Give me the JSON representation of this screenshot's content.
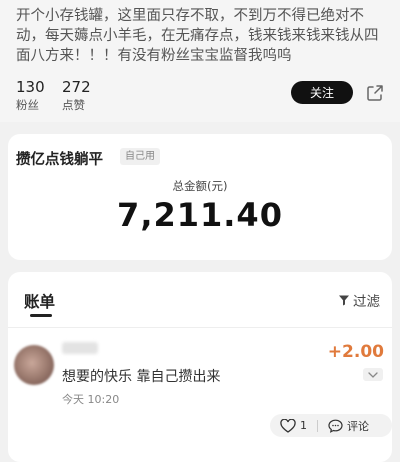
{
  "profile": {
    "bio": "开个小存钱罐，这里面只存不取，不到万不得已绝对不动，每天薅点小羊毛，在无痛存点，钱来钱来钱来钱从四面八方来！！！有没有粉丝宝宝监督我呜呜",
    "fans_count": "130",
    "fans_label": "粉丝",
    "likes_count": "272",
    "likes_label": "点赞",
    "follow_label": "关注",
    "share_icon": "share-icon"
  },
  "jar": {
    "title": "攒亿点钱躺平",
    "tag": "自己用",
    "total_label": "总金额(元)",
    "total_value": "7,211.40"
  },
  "bill": {
    "tab_label": "账单",
    "filter_label": "过滤",
    "entry": {
      "note": "想要的快乐 靠自己攒出来",
      "time": "今天 10:20",
      "amount": "+2.00",
      "like_count": "1",
      "comment_label": "评论"
    }
  },
  "colors": {
    "amount": "#e07a3c",
    "follow_bg": "#111111"
  }
}
